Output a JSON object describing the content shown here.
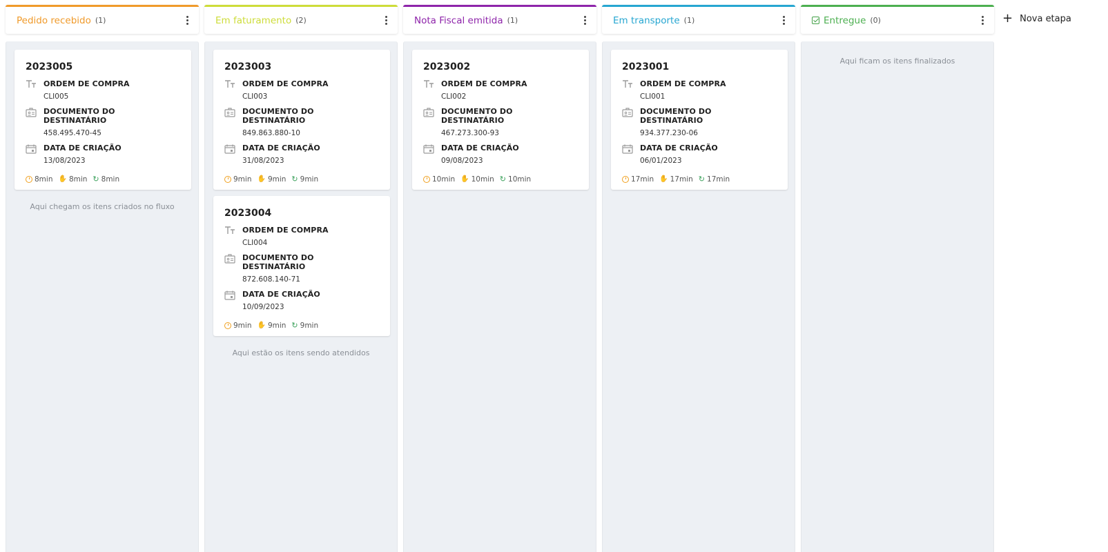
{
  "columns": [
    {
      "title": "Pedido recebido",
      "count": "(1)",
      "color": "#f09a2a",
      "cards": [
        {
          "id": "2023005",
          "order_label": "ORDEM DE COMPRA",
          "order": "CLI005",
          "doc_label": "DOCUMENTO DO DESTINATÁRIO",
          "doc": "458.495.470-45",
          "date_label": "DATA DE CRIAÇÃO",
          "date": "13/08/2023",
          "t1": "8min",
          "t2": "8min",
          "t3": "8min"
        }
      ],
      "note": "Aqui chegam os itens criados no fluxo"
    },
    {
      "title": "Em faturamento",
      "count": "(2)",
      "color": "#cddc39",
      "cards": [
        {
          "id": "2023003",
          "order_label": "ORDEM DE COMPRA",
          "order": "CLI003",
          "doc_label": "DOCUMENTO DO DESTINATÁRIO",
          "doc": "849.863.880-10",
          "date_label": "DATA DE CRIAÇÃO",
          "date": "31/08/2023",
          "t1": "9min",
          "t2": "9min",
          "t3": "9min"
        },
        {
          "id": "2023004",
          "order_label": "ORDEM DE COMPRA",
          "order": "CLI004",
          "doc_label": "DOCUMENTO DO DESTINATÁRIO",
          "doc": "872.608.140-71",
          "date_label": "DATA DE CRIAÇÃO",
          "date": "10/09/2023",
          "t1": "9min",
          "t2": "9min",
          "t3": "9min"
        }
      ],
      "note": "Aqui estão os itens sendo atendidos"
    },
    {
      "title": "Nota Fiscal emitida",
      "count": "(1)",
      "color": "#8e24aa",
      "cards": [
        {
          "id": "2023002",
          "order_label": "ORDEM DE COMPRA",
          "order": "CLI002",
          "doc_label": "DOCUMENTO DO DESTINATÁRIO",
          "doc": "467.273.300-93",
          "date_label": "DATA DE CRIAÇÃO",
          "date": "09/08/2023",
          "t1": "10min",
          "t2": "10min",
          "t3": "10min"
        }
      ],
      "note": ""
    },
    {
      "title": "Em transporte",
      "count": "(1)",
      "color": "#26a6d1",
      "cards": [
        {
          "id": "2023001",
          "order_label": "ORDEM DE COMPRA",
          "order": "CLI001",
          "doc_label": "DOCUMENTO DO DESTINATÁRIO",
          "doc": "934.377.230-06",
          "date_label": "DATA DE CRIAÇÃO",
          "date": "06/01/2023",
          "t1": "17min",
          "t2": "17min",
          "t3": "17min"
        }
      ],
      "note": ""
    },
    {
      "title": "Entregue",
      "count": "(0)",
      "color": "#4caf50",
      "cards": [],
      "note": "Aqui ficam os itens finalizados"
    }
  ],
  "new_stage_label": "Nova etapa",
  "icons": {
    "order": "text-format-icon",
    "doc": "id-card-icon",
    "date": "calendar-icon",
    "t1": "clock-icon",
    "t2": "hand-icon",
    "t3": "refresh-icon",
    "menu": "more-vert-icon",
    "done": "check-box-icon",
    "add": "plus-icon"
  }
}
